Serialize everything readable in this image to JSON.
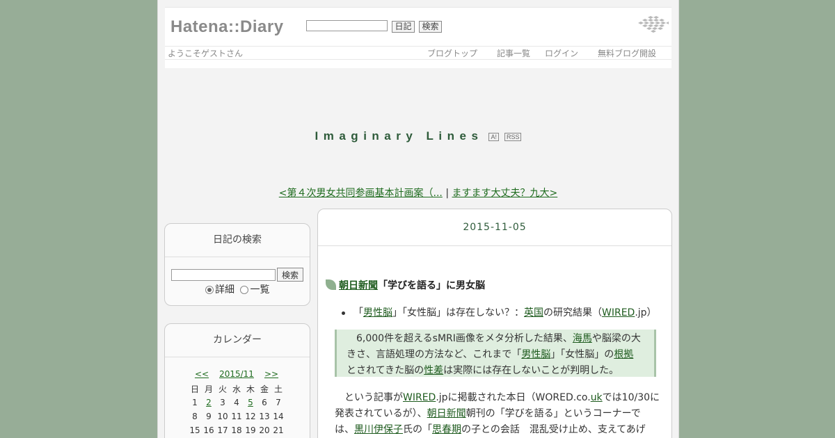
{
  "header": {
    "logo": "Hatena::Diary",
    "btn_diary": "日記",
    "btn_search": "検索",
    "welcome": "ようこそゲストさん",
    "nav": [
      "ブログトップ",
      "記事一覧",
      "ログイン",
      "無料ブログ開設"
    ]
  },
  "blog": {
    "title": "Imaginary Lines",
    "icon_a": "A!",
    "icon_rss": "RSS",
    "prev_link": "<第４次男女共同参画基本計画案（...",
    "separator": "|",
    "next_link": "ますます大丈夫？九大>"
  },
  "sidebar": {
    "search": {
      "title": "日記の検索",
      "button": "検索",
      "opt_detail": "詳細",
      "opt_list": "一覧"
    },
    "calendar": {
      "title": "カレンダー",
      "prev": "<<",
      "month": "2015/11",
      "next": ">>",
      "weekdays": [
        "日",
        "月",
        "火",
        "水",
        "木",
        "金",
        "土"
      ],
      "week1": [
        "1",
        "2",
        "3",
        "4",
        "5",
        "6",
        "7"
      ],
      "week2": [
        "8",
        "9",
        "10",
        "11",
        "12",
        "13",
        "14"
      ],
      "week3": [
        "15",
        "16",
        "17",
        "18",
        "19",
        "20",
        "21"
      ]
    }
  },
  "entry": {
    "date": "2015-11-05",
    "section_link": "朝日新聞",
    "section_rest": "「学びを語る」に男女脳",
    "bullet": {
      "t1": "「",
      "l1": "男性脳",
      "t2": "」「女性脳」は存在しない？：",
      "l2": "英国",
      "t3": "の研究結果（",
      "l3": "WIRED",
      "t4": ".jp）"
    },
    "quote": {
      "a1": "6,000件を超えるsMRI画像をメタ分析した結果、",
      "a_link": "海馬",
      "a2": "や脳梁の大",
      "b1": "きさ、言語処理の方法など、これまで「",
      "b_link1": "男性脳",
      "b2": "」「女性脳」の",
      "b_link2": "根拠",
      "c1": "とされてきた脳の",
      "c_link": "性差",
      "c2": "は実際には存在しないことが判明した。"
    },
    "para": {
      "a1": "という記事が",
      "a_link1": "WIRED",
      "a2": ".jpに掲載された本日（WORED.co.",
      "a_link2": "uk",
      "a3": "では10/30に",
      "b1": "発表されているが）、",
      "b_link": "朝日新聞",
      "b2": "朝刊の「学びを語る」というコーナーで",
      "c1": "は、",
      "c_link1": "黒川伊保子",
      "c2": "氏の「",
      "c_link2": "思春期",
      "c3": "の子との会話　混乱受け止め、支えてあげ"
    }
  }
}
